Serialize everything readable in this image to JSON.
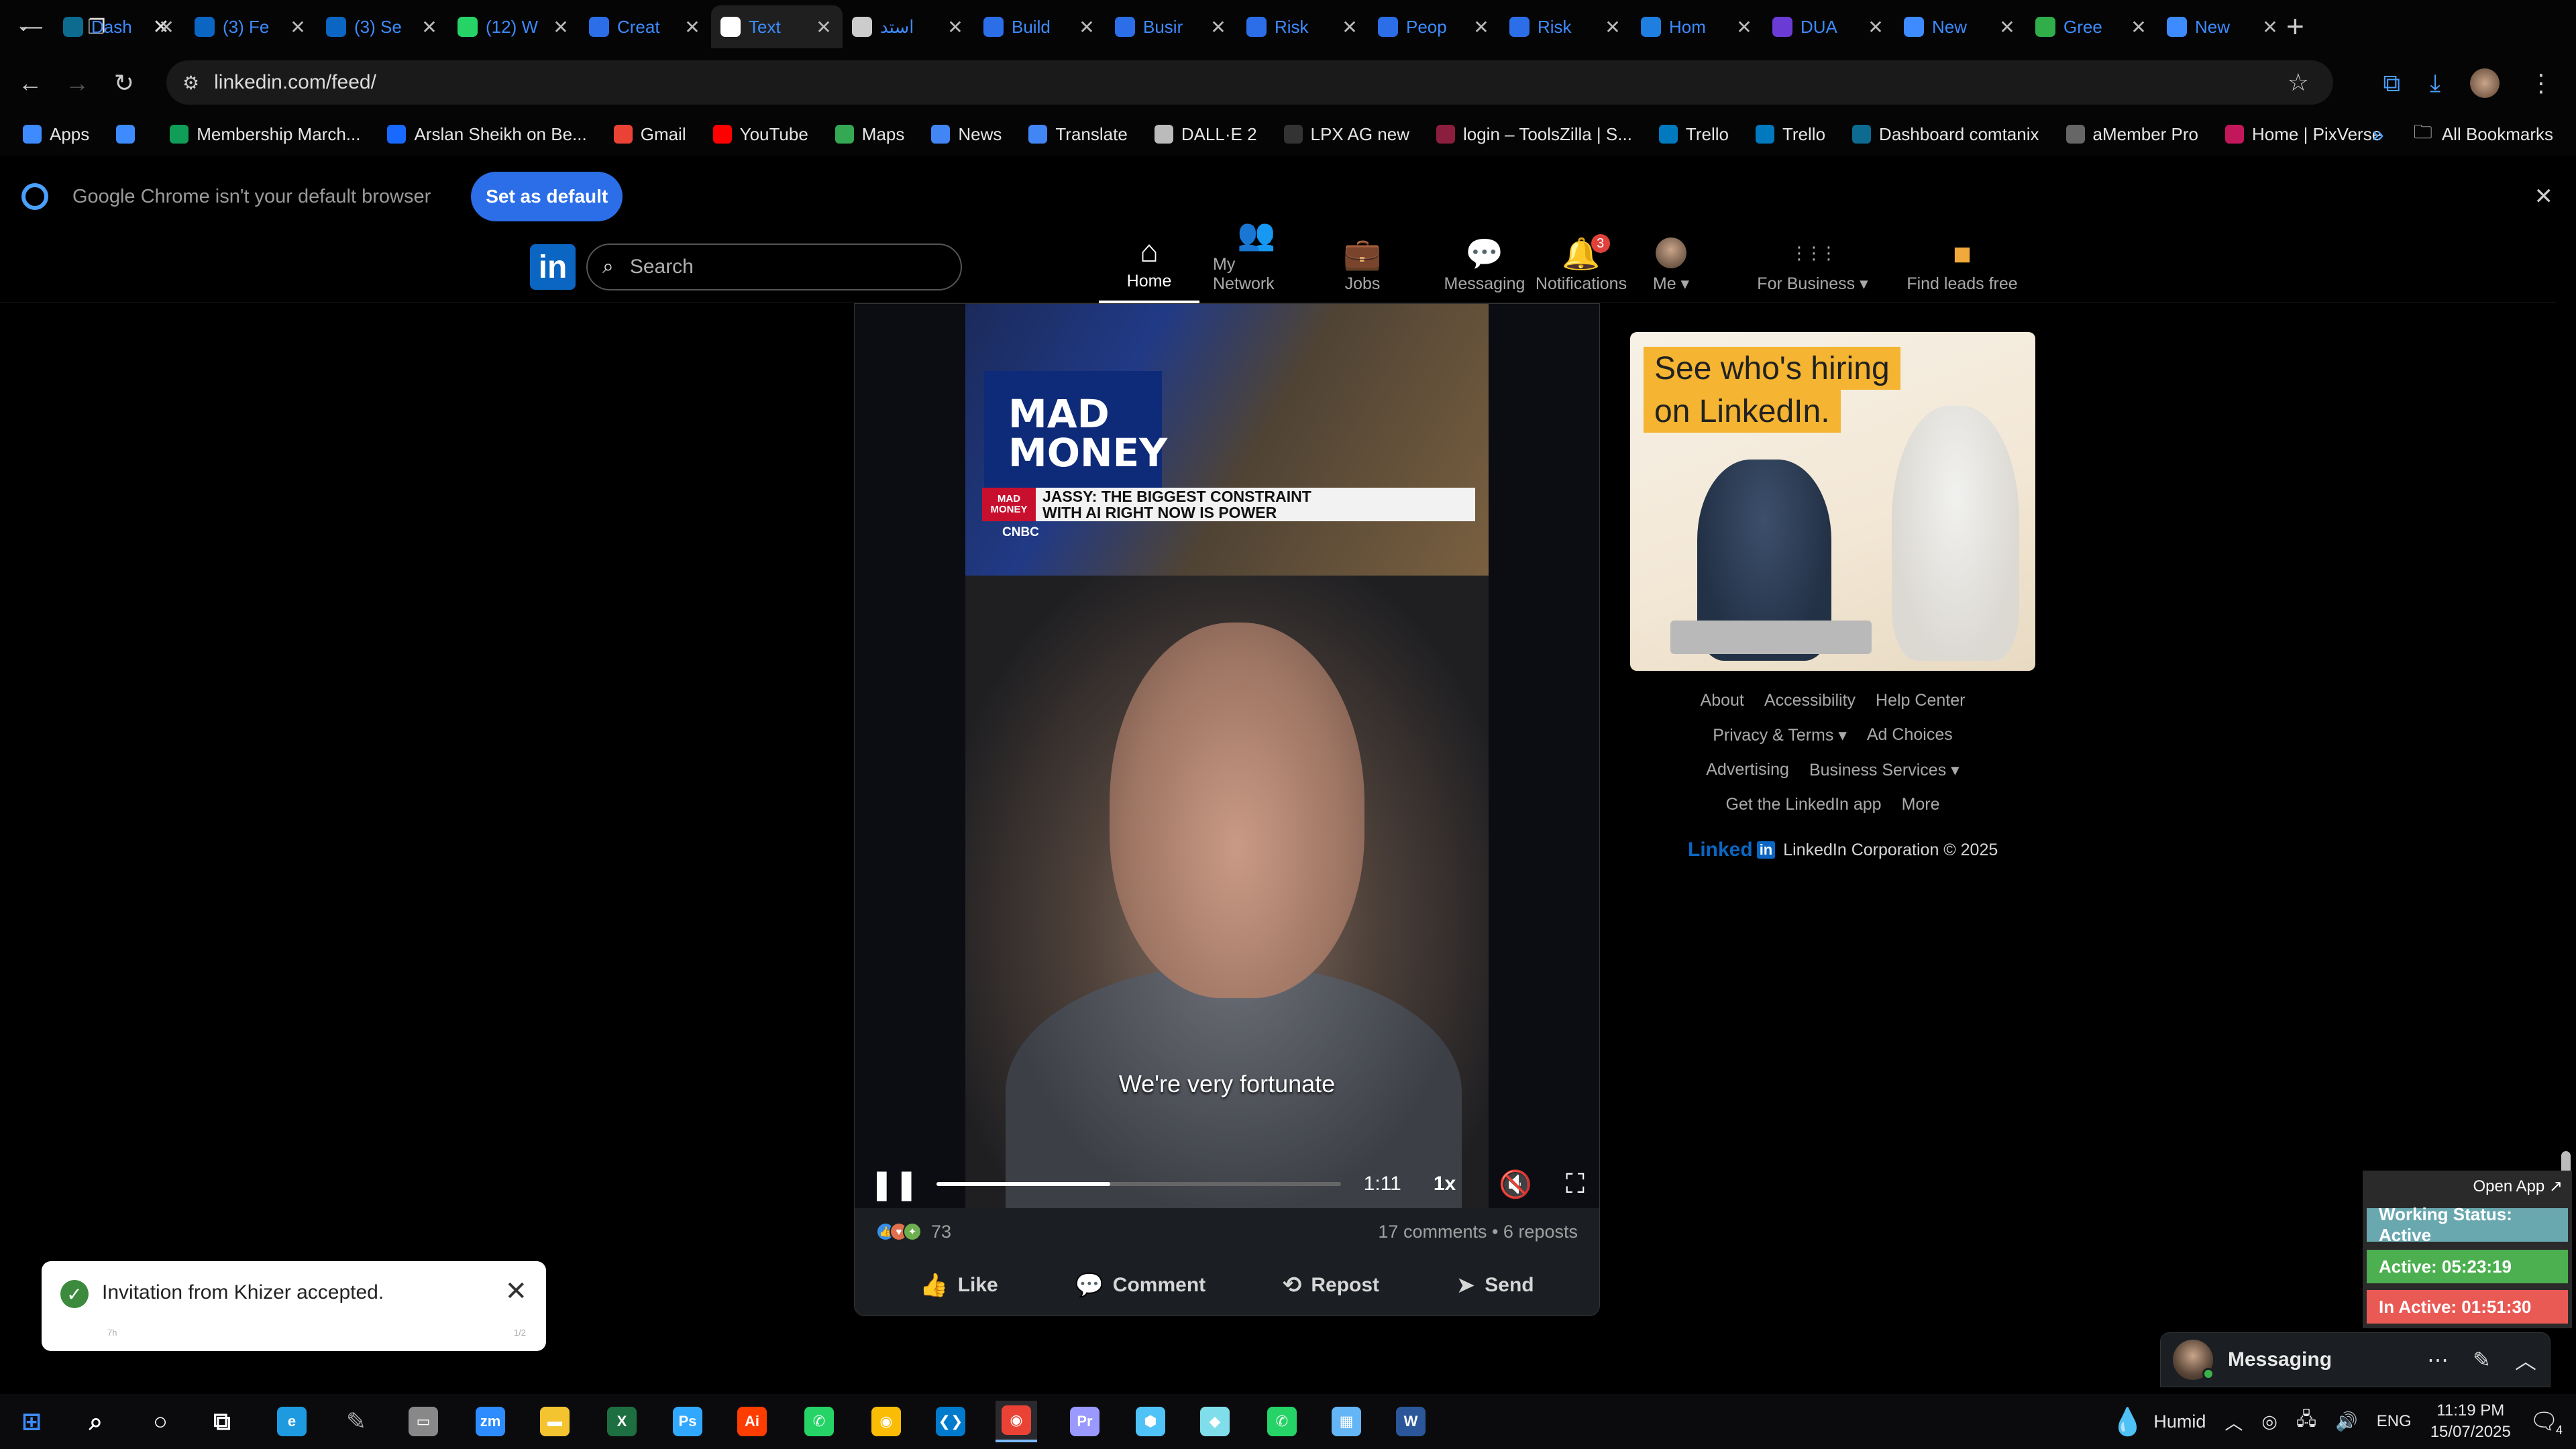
{
  "browser": {
    "tabs": [
      {
        "title": "Dash",
        "icon": "dashboard-icon",
        "color": "#0c6b8f"
      },
      {
        "title": "(3) Fe",
        "icon": "linkedin-icon",
        "color": "#0a66c2"
      },
      {
        "title": "(3) Se",
        "icon": "linkedin-icon",
        "color": "#0a66c2"
      },
      {
        "title": "(12) W",
        "icon": "whatsapp-icon",
        "color": "#25d366"
      },
      {
        "title": "Creat",
        "icon": "google-forms-icon",
        "color": "#2b6ee8"
      },
      {
        "title": "Text",
        "icon": "text-app-icon",
        "color": "#ffffff"
      },
      {
        "title": "استد",
        "icon": "openai-icon",
        "color": "#cccccc"
      },
      {
        "title": "Build",
        "icon": "google-forms-icon",
        "color": "#2b6ee8"
      },
      {
        "title": "Busir",
        "icon": "google-forms-icon",
        "color": "#2b6ee8"
      },
      {
        "title": "Risk",
        "icon": "google-forms-icon",
        "color": "#2b6ee8"
      },
      {
        "title": "Peop",
        "icon": "google-forms-icon",
        "color": "#2b6ee8"
      },
      {
        "title": "Risk",
        "icon": "google-forms-icon",
        "color": "#2b6ee8"
      },
      {
        "title": "Hom",
        "icon": "canva-icon",
        "color": "#1f7fe0"
      },
      {
        "title": "DUA",
        "icon": "video-app-icon",
        "color": "#6b3bd6"
      },
      {
        "title": "New",
        "icon": "chrome-icon",
        "color": "#3d8bff"
      },
      {
        "title": "Gree",
        "icon": "palm-tree-icon",
        "color": "#2fae4a"
      },
      {
        "title": "New",
        "icon": "chrome-icon",
        "color": "#3d8bff"
      }
    ],
    "active_tab_index": 5,
    "new_tab_label": "+",
    "url": "linkedin.com/feed/",
    "bookmarks": [
      {
        "label": "Apps",
        "icon": "apps-grid-icon",
        "color": "#3d8bff"
      },
      {
        "label": "",
        "icon": "tab-groups-icon",
        "color": "#3d8bff"
      },
      {
        "label": "Membership March...",
        "icon": "membership-icon",
        "color": "#0f9d58"
      },
      {
        "label": "Arslan Sheikh on Be...",
        "icon": "behance-icon",
        "color": "#1769ff"
      },
      {
        "label": "Gmail",
        "icon": "gmail-icon",
        "color": "#ea4335"
      },
      {
        "label": "YouTube",
        "icon": "youtube-icon",
        "color": "#ff0000"
      },
      {
        "label": "Maps",
        "icon": "maps-icon",
        "color": "#34a853"
      },
      {
        "label": "News",
        "icon": "news-icon",
        "color": "#4285f4"
      },
      {
        "label": "Translate",
        "icon": "translate-icon",
        "color": "#4285f4"
      },
      {
        "label": "DALL·E 2",
        "icon": "openai-icon",
        "color": "#bbbbbb"
      },
      {
        "label": "LPX AG new",
        "icon": "page-icon",
        "color": "#333333"
      },
      {
        "label": "login – ToolsZilla | S...",
        "icon": "toolszilla-icon",
        "color": "#8b1e3f"
      },
      {
        "label": "Trello",
        "icon": "trello-icon",
        "color": "#0079bf"
      },
      {
        "label": "Trello",
        "icon": "trello-icon",
        "color": "#0079bf"
      },
      {
        "label": "Dashboard comtanix",
        "icon": "dashboard-icon",
        "color": "#0c6b8f"
      },
      {
        "label": "aMember Pro",
        "icon": "amember-icon",
        "color": "#666666"
      },
      {
        "label": "Home | PixVerse",
        "icon": "pixverse-icon",
        "color": "#c2185b"
      }
    ],
    "more_bookmarks_label": "»",
    "all_bookmarks_label": "All Bookmarks",
    "default_banner": {
      "message": "Google Chrome isn't your default browser",
      "button": "Set as default",
      "close": "✕"
    }
  },
  "linkedin": {
    "logo": "in",
    "search_placeholder": "Search",
    "nav": [
      {
        "label": "Home",
        "icon": "home-icon",
        "glyph": "⌂"
      },
      {
        "label": "My Network",
        "icon": "network-icon",
        "glyph": "👥"
      },
      {
        "label": "Jobs",
        "icon": "briefcase-icon",
        "glyph": "💼"
      },
      {
        "label": "Messaging",
        "icon": "chat-icon",
        "glyph": "💬"
      },
      {
        "label": "Notifications",
        "icon": "bell-icon",
        "glyph": "🔔",
        "badge": "3"
      },
      {
        "label": "Me ▾",
        "icon": "avatar-icon",
        "glyph": "●"
      },
      {
        "label": "For Business ▾",
        "icon": "grid-icon",
        "glyph": "⋮⋮⋮"
      },
      {
        "label": "Find leads free",
        "icon": "premium-icon",
        "glyph": "■"
      }
    ],
    "post": {
      "video": {
        "tv_logo": "MAD\nMONEY",
        "lower_third_brand": "MAD\nMONEY",
        "lower_third_text": "JASSY: THE BIGGEST CONSTRAINT\nWITH AI RIGHT NOW IS POWER",
        "network": "CNBC",
        "caption": "We're very fortunate",
        "time": "1:11",
        "speed": "1x",
        "progress": 0.43
      },
      "reactions_count": "73",
      "comments_reposts": "17 comments • 6 reposts",
      "actions": [
        {
          "label": "Like",
          "icon": "thumbs-up-icon",
          "glyph": "👍"
        },
        {
          "label": "Comment",
          "icon": "comment-icon",
          "glyph": "💬"
        },
        {
          "label": "Repost",
          "icon": "repost-icon",
          "glyph": "⟲"
        },
        {
          "label": "Send",
          "icon": "send-icon",
          "glyph": "➤"
        }
      ]
    },
    "ad": {
      "line1": "See who's hiring",
      "line2": "on LinkedIn."
    },
    "footer": {
      "rows": [
        [
          "About",
          "Accessibility",
          "Help Center"
        ],
        [
          "Privacy & Terms ▾",
          "Ad Choices"
        ],
        [
          "Advertising",
          "Business Services ▾"
        ],
        [
          "Get the LinkedIn app",
          "More"
        ]
      ],
      "brand": "Linked",
      "brand_in": "in",
      "copyright": "LinkedIn Corporation © 2025"
    },
    "messaging": {
      "label": "Messaging"
    },
    "toast": {
      "message": "Invitation from Khizer accepted.",
      "left_meta": "7h",
      "right_meta": "1/2"
    }
  },
  "work_widget": {
    "open_app": "Open App ↗",
    "status": "Working Status: Active",
    "active": "Active: 05:23:19",
    "inactive": "In Active: 01:51:30"
  },
  "taskbar": {
    "apps": [
      {
        "name": "windows-start",
        "label": "⊞",
        "color": "#3d8bff"
      },
      {
        "name": "search",
        "label": "⌕",
        "color": "#ffffff"
      },
      {
        "name": "cortana",
        "label": "○",
        "color": "#ffffff"
      },
      {
        "name": "task-view",
        "label": "⧉",
        "color": "#ffffff"
      },
      {
        "name": "edge",
        "label": "e",
        "color": "#1e9be0"
      },
      {
        "name": "pen",
        "label": "✎",
        "color": "#aaaaaa"
      },
      {
        "name": "terminal",
        "label": "▭",
        "color": "#888888"
      },
      {
        "name": "zoom",
        "label": "zm",
        "color": "#2d8cff"
      },
      {
        "name": "file-explorer",
        "label": "▬",
        "color": "#f4c430"
      },
      {
        "name": "excel",
        "label": "X",
        "color": "#1d6f42"
      },
      {
        "name": "photoshop",
        "label": "Ps",
        "color": "#31a8ff"
      },
      {
        "name": "illustrator",
        "label": "Ai",
        "color": "#ff3d00"
      },
      {
        "name": "phone-link",
        "label": "✆",
        "color": "#25d366"
      },
      {
        "name": "chrome",
        "label": "◉",
        "color": "#fbbc05"
      },
      {
        "name": "vscode",
        "label": "❮❯",
        "color": "#007acc"
      },
      {
        "name": "chrome-active",
        "label": "◉",
        "color": "#ea4335"
      },
      {
        "name": "premiere",
        "label": "Pr",
        "color": "#9999ff"
      },
      {
        "name": "app-hex",
        "label": "⬢",
        "color": "#4fc3f7"
      },
      {
        "name": "app-notes",
        "label": "◆",
        "color": "#80deea"
      },
      {
        "name": "whatsapp",
        "label": "✆",
        "color": "#25d366"
      },
      {
        "name": "calculator",
        "label": "▦",
        "color": "#64b5f6"
      },
      {
        "name": "word",
        "label": "W",
        "color": "#2b579a"
      }
    ],
    "weather": "Humid",
    "language": "ENG",
    "time": "11:19 PM",
    "date": "15/07/2025",
    "notification_count": "4"
  }
}
